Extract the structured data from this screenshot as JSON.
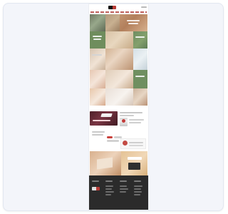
{
  "screen": {
    "title": "",
    "background_color": "#ffffff",
    "frame_color": "#f3f5fa"
  },
  "page_preview": {
    "header": {
      "logo_icon": "brand-logo-icon",
      "menu_icon": "menu-icon",
      "accent_color": "#b83a36"
    },
    "sections": [
      "header",
      "navigation-strip",
      "hero-grid",
      "promo-row",
      "feature-block",
      "promo-banner",
      "footer"
    ],
    "colors": {
      "nav_red": "#b84d49",
      "promo_dark_red": "#4d1f28",
      "green": "#6f8d5d",
      "footer": "#2b2b2b"
    }
  }
}
